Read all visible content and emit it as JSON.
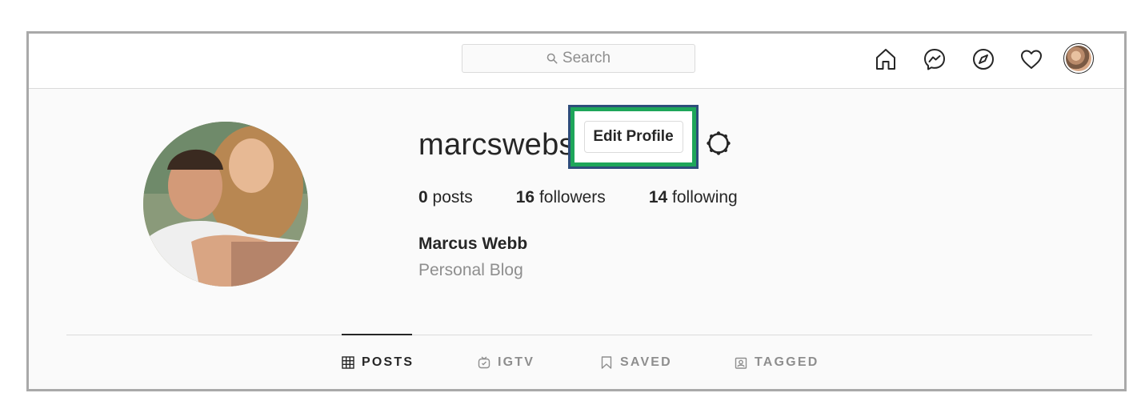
{
  "search": {
    "placeholder": "Search"
  },
  "nav": {
    "icons": [
      "home-icon",
      "messenger-icon",
      "explore-icon",
      "activity-heart-icon"
    ]
  },
  "profile": {
    "username": "marcswebs",
    "edit_profile_label": "Edit Profile",
    "stats": [
      {
        "count": "0",
        "label": "posts"
      },
      {
        "count": "16",
        "label": "followers"
      },
      {
        "count": "14",
        "label": "following"
      }
    ],
    "full_name": "Marcus Webb",
    "bio": "Personal Blog"
  },
  "tabs": [
    {
      "label": "POSTS",
      "icon": "grid-icon",
      "active": true
    },
    {
      "label": "IGTV",
      "icon": "igtv-icon",
      "active": false
    },
    {
      "label": "SAVED",
      "icon": "bookmark-icon",
      "active": false
    },
    {
      "label": "TAGGED",
      "icon": "tagged-icon",
      "active": false
    }
  ],
  "colors": {
    "highlight_fill": "#1ea65a",
    "highlight_border": "#2d4d7a",
    "text": "#262626",
    "secondary_text": "#8e8e8e"
  }
}
